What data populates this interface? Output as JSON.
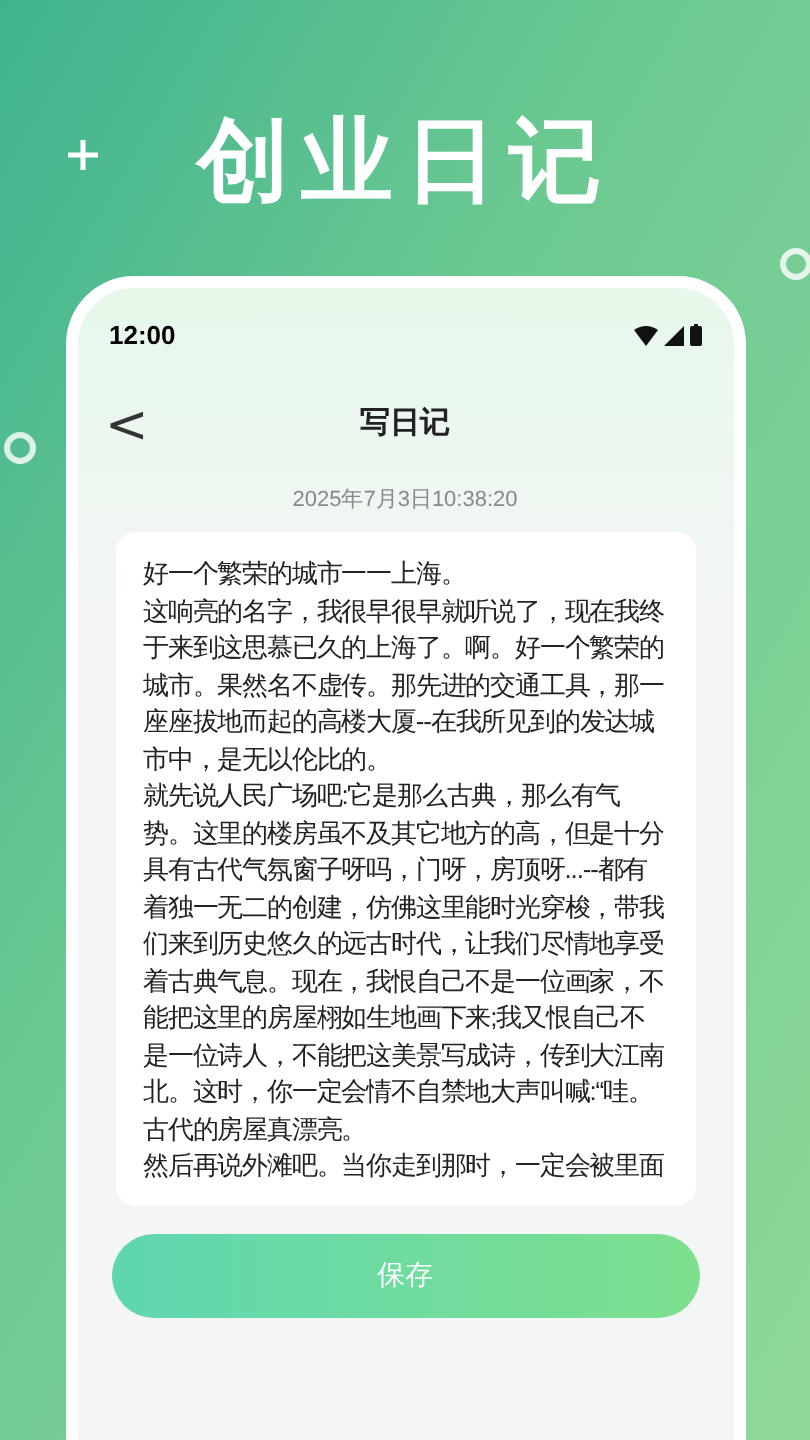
{
  "headline": "创业日记",
  "status_bar": {
    "time": "12:00"
  },
  "header": {
    "back": "<",
    "title": "写日记"
  },
  "timestamp": "2025年7月3日10:38:20",
  "entry": {
    "paragraphs": [
      "好一个繁荣的城市一一上海。",
      "这响亮的名字，我很早很早就听说了，现在我终于来到这思慕已久的上海了。啊。好一个繁荣的城市。果然名不虚传。那先进的交通工具，那一座座拔地而起的高楼大厦--在我所见到的发达城市中，是无以伦比的。",
      "就先说人民广场吧:它是那么古典，那么有气势。这里的楼房虽不及其它地方的高，但是十分具有古代气氛窗子呀吗，门呀，房顶呀...--都有着独一无二的创建，仿佛这里能时光穿梭，带我们来到历史悠久的远古时代，让我们尽情地享受着古典气息。现在，我恨自己不是一位画家，不能把这里的房屋栩如生地画下来;我又恨自己不是一位诗人，不能把这美景写成诗，传到大江南北。这时，你一定会情不自禁地大声叫喊:“哇。古代的房屋真漂亮。",
      "然后再说外滩吧。当你走到那时，一定会被里面"
    ]
  },
  "save_button": "保存"
}
